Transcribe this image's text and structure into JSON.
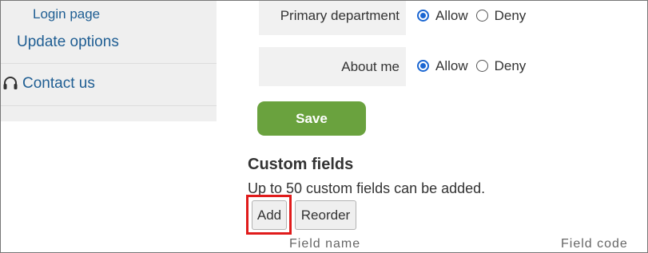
{
  "sidebar": {
    "login_page": "Login page",
    "update_options": "Update options",
    "contact_us": "Contact us"
  },
  "permissions": [
    {
      "label": "Primary department",
      "allow": "Allow",
      "deny": "Deny",
      "selected": "allow"
    },
    {
      "label": "About me",
      "allow": "Allow",
      "deny": "Deny",
      "selected": "allow"
    }
  ],
  "save_label": "Save",
  "custom_fields": {
    "heading": "Custom fields",
    "description": "Up to 50 custom fields can be added.",
    "add_label": "Add",
    "reorder_label": "Reorder",
    "columns": [
      "Field name",
      "Field code"
    ]
  },
  "colors": {
    "link": "#1f5e93",
    "save_button": "#6aa23e",
    "highlight": "#e01b1b",
    "radio_selected": "#1a66d2"
  },
  "icons": {
    "contact": "headset-icon"
  }
}
